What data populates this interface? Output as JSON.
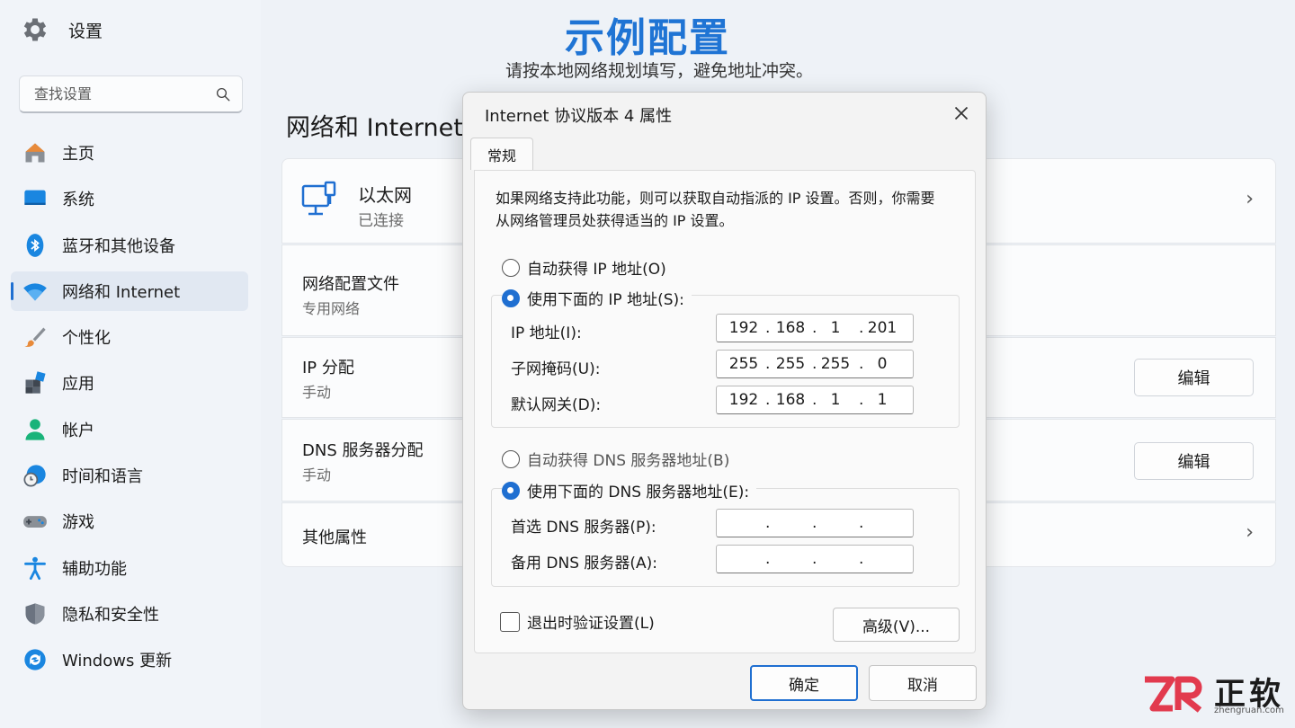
{
  "app": {
    "title": "设置",
    "icon": "gear-icon"
  },
  "search": {
    "placeholder": "查找设置",
    "icon": "search-icon"
  },
  "sidebar": {
    "items": [
      {
        "label": "主页",
        "icon": "home-icon"
      },
      {
        "label": "系统",
        "icon": "display-icon"
      },
      {
        "label": "蓝牙和其他设备",
        "icon": "bluetooth-icon"
      },
      {
        "label": "网络和 Internet",
        "icon": "wifi-icon",
        "active": true
      },
      {
        "label": "个性化",
        "icon": "brush-icon"
      },
      {
        "label": "应用",
        "icon": "apps-icon"
      },
      {
        "label": "帐户",
        "icon": "account-icon"
      },
      {
        "label": "时间和语言",
        "icon": "globe-clock-icon"
      },
      {
        "label": "游戏",
        "icon": "gamepad-icon"
      },
      {
        "label": "辅助功能",
        "icon": "accessibility-icon"
      },
      {
        "label": "隐私和安全性",
        "icon": "shield-icon"
      },
      {
        "label": "Windows 更新",
        "icon": "update-icon"
      }
    ]
  },
  "banner": {
    "title": "示例配置",
    "subtitle": "请按本地网络规划填写，避免地址冲突。"
  },
  "main": {
    "page_title": "网络和 Internet",
    "ethernet": {
      "title": "以太网",
      "status": "已连接",
      "icon": "ethernet-icon"
    },
    "rows": [
      {
        "title": "网络配置文件",
        "sub": "专用网络"
      },
      {
        "title": "IP 分配",
        "sub": "手动",
        "button": "编辑"
      },
      {
        "title": "DNS 服务器分配",
        "sub": "手动",
        "button": "编辑"
      },
      {
        "title": "其他属性"
      }
    ]
  },
  "dialog": {
    "title": "Internet 协议版本 4 属性",
    "tab": "常规",
    "description": "如果网络支持此功能，则可以获取自动指派的 IP 设置。否则，你需要从网络管理员处获得适当的 IP 设置。",
    "ip_auto_label": "自动获得 IP 地址(O)",
    "ip_manual_label": "使用下面的 IP 地址(S):",
    "ip_auto_selected": false,
    "fields": {
      "ip": {
        "label": "IP 地址(I):",
        "octets": [
          "192",
          "168",
          "1",
          "201"
        ]
      },
      "mask": {
        "label": "子网掩码(U):",
        "octets": [
          "255",
          "255",
          "255",
          "0"
        ]
      },
      "gateway": {
        "label": "默认网关(D):",
        "octets": [
          "192",
          "168",
          "1",
          "1"
        ]
      }
    },
    "dns_auto_label": "自动获得 DNS 服务器地址(B)",
    "dns_manual_label": "使用下面的 DNS 服务器地址(E):",
    "dns_fields": {
      "preferred": {
        "label": "首选 DNS 服务器(P):",
        "octets": [
          "",
          "",
          "",
          ""
        ]
      },
      "alternate": {
        "label": "备用 DNS 服务器(A):",
        "octets": [
          "",
          "",
          "",
          ""
        ]
      }
    },
    "validate_label": "退出时验证设置(L)",
    "validate_checked": false,
    "advanced_button": "高级(V)...",
    "ok_button": "确定",
    "cancel_button": "取消"
  },
  "watermark": {
    "cn": "正软",
    "url": "zhengruan.com"
  },
  "colors": {
    "accent": "#1f6fd1",
    "headline": "#1f74d4",
    "logo_red": "#e23a4e"
  }
}
